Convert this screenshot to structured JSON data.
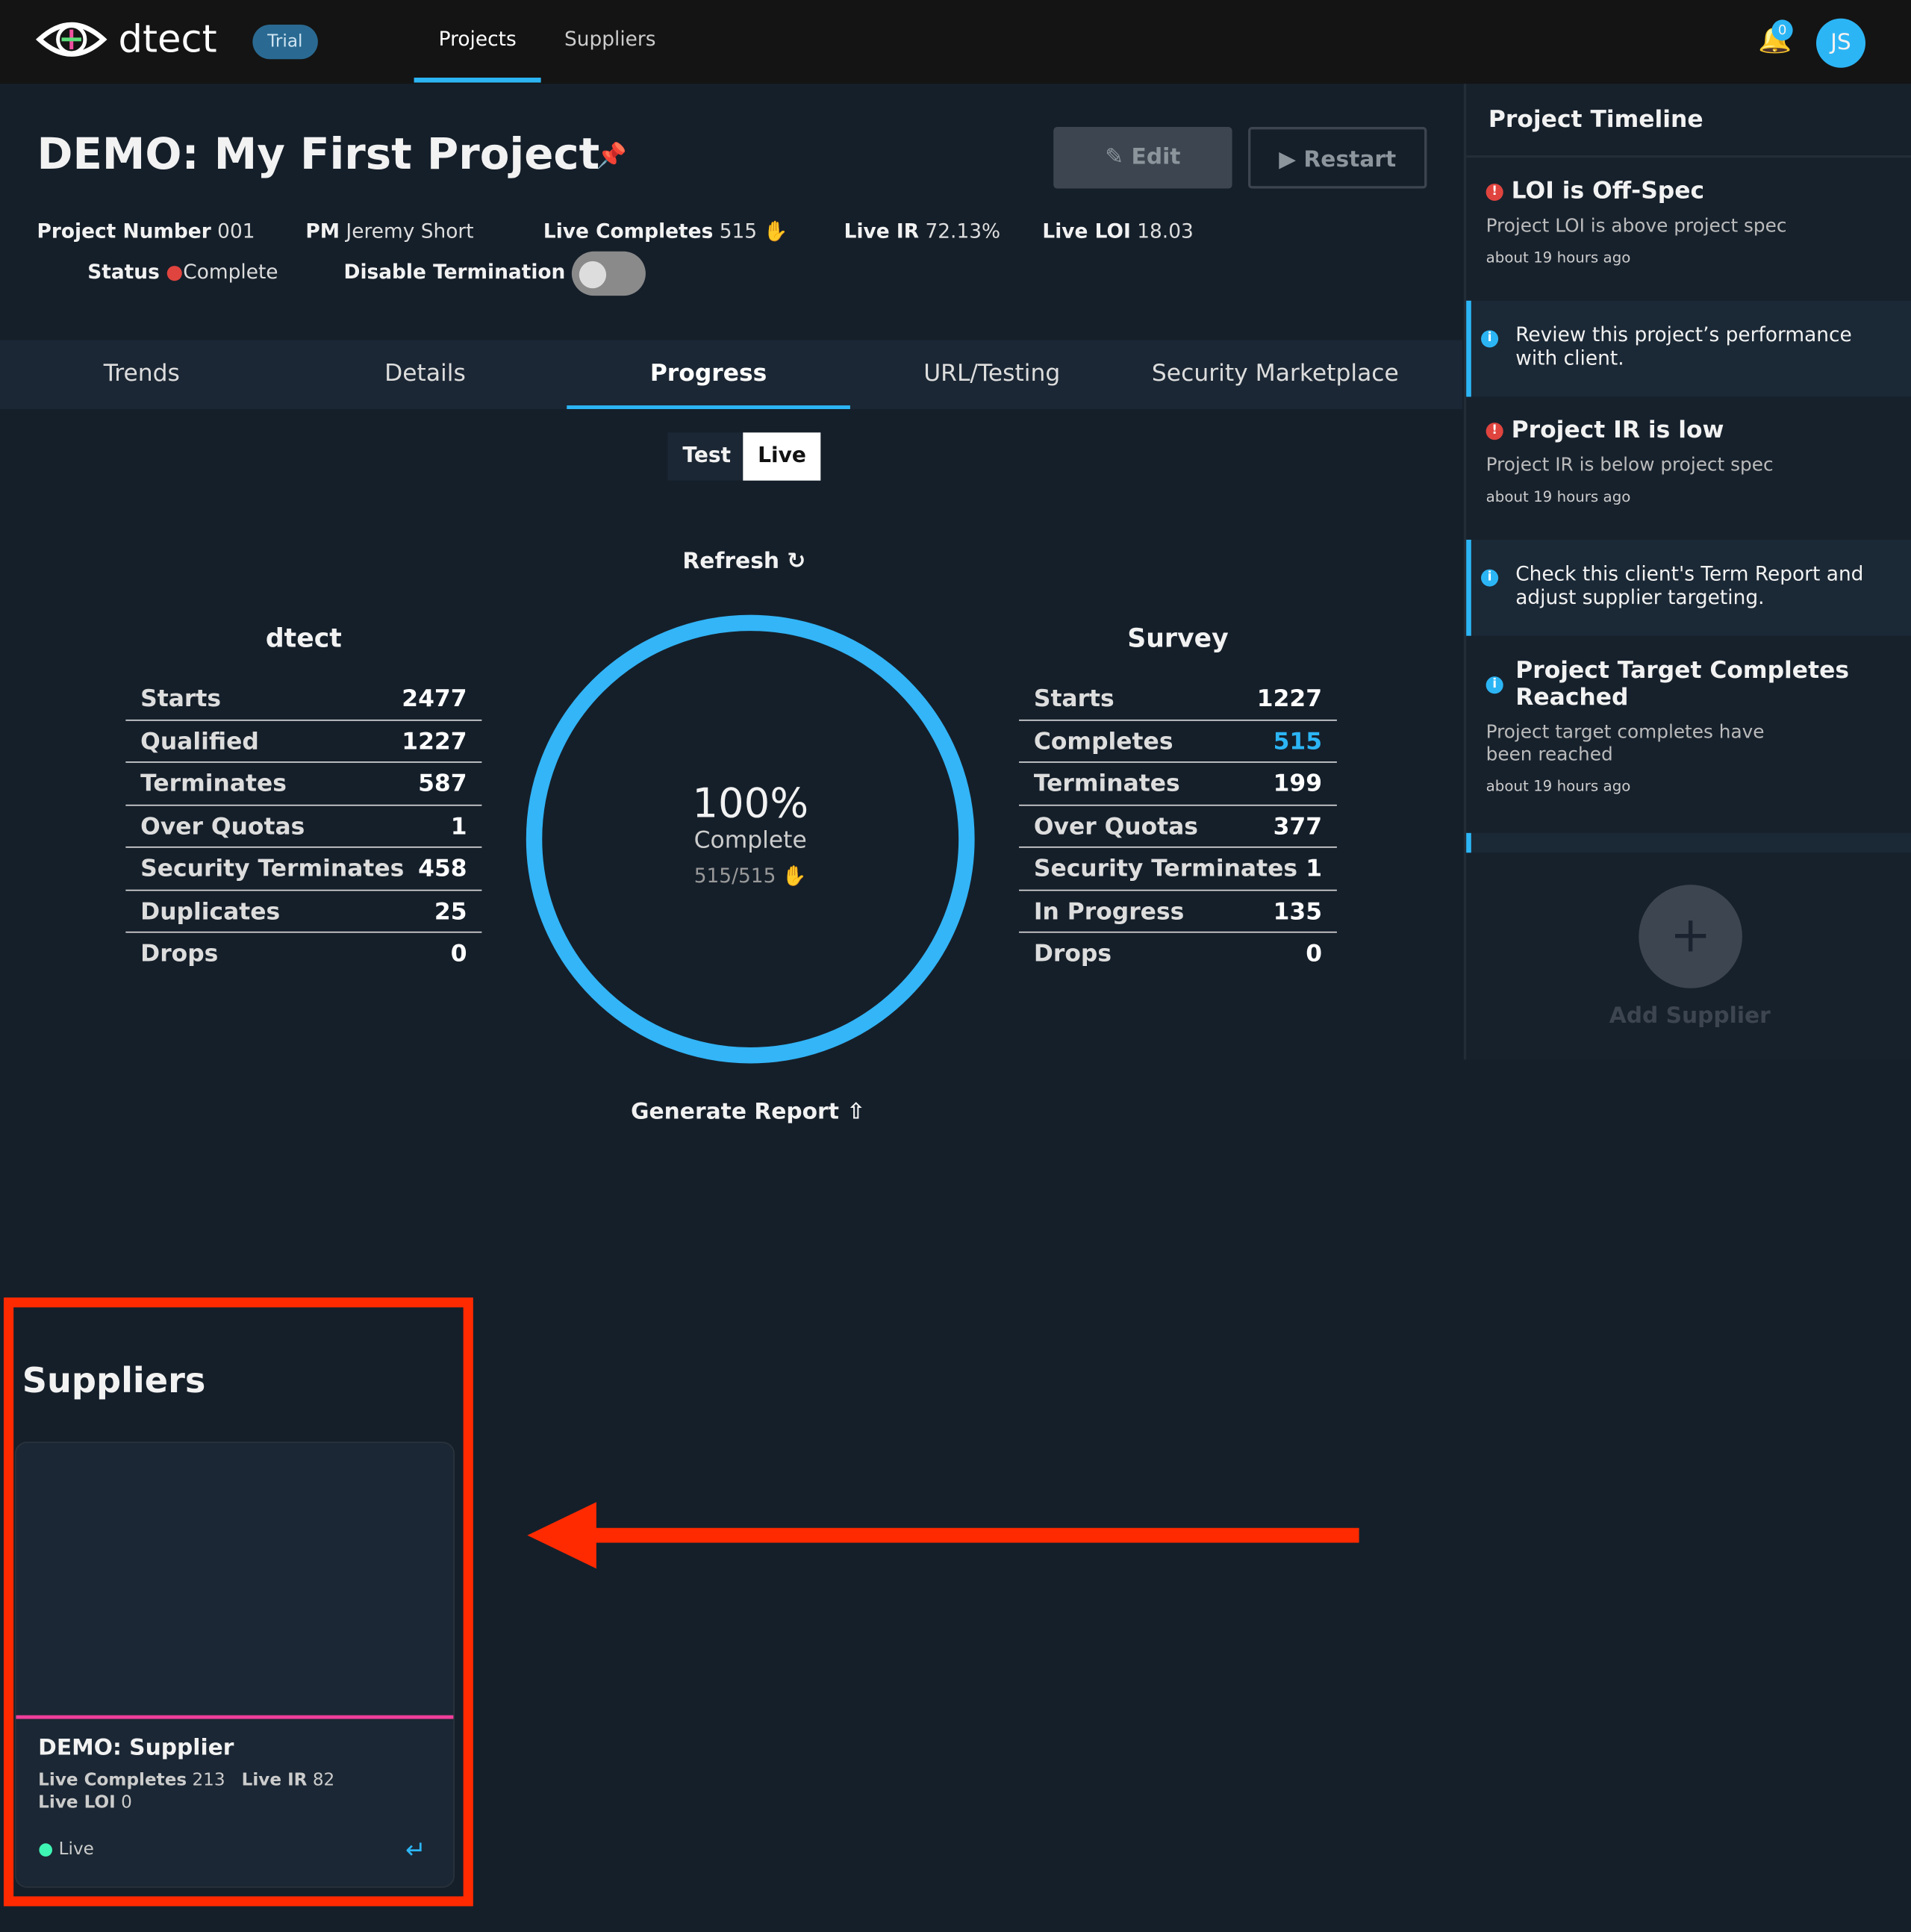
{
  "colors": {
    "accent": "#2cb5f5",
    "status_complete": "#e0443e",
    "live": "#3ef5b4",
    "annotation": "#ff2a00"
  },
  "nav": {
    "brand": "dtect",
    "badge": "Trial",
    "items": [
      {
        "label": "Projects",
        "active": true
      },
      {
        "label": "Suppliers"
      }
    ],
    "notifications": "0",
    "avatar": "JS"
  },
  "project": {
    "title": "DEMO: My First Project",
    "edit": "Edit",
    "restart": "Restart",
    "number_label": "Project Number",
    "number": "001",
    "pm_label": "PM",
    "pm": "Jeremy Short",
    "live_completes_label": "Live Completes",
    "live_completes": "515",
    "live_ir_label": "Live IR",
    "live_ir": "72.13%",
    "live_loi_label": "Live LOI",
    "live_loi": "18.03",
    "status_label": "Status",
    "status": "Complete",
    "disable_term_label": "Disable Termination",
    "disable_term_on": false
  },
  "tabs": [
    "Trends",
    "Details",
    "Progress",
    "URL/Testing",
    "Security Marketplace"
  ],
  "active_tab": "Progress",
  "mode": {
    "test": "Test",
    "live": "Live",
    "selected": "Live"
  },
  "refresh": "Refresh",
  "dtect": {
    "title": "dtect",
    "rows": [
      [
        "Starts",
        "2477"
      ],
      [
        "Qualified",
        "1227"
      ],
      [
        "Terminates",
        "587"
      ],
      [
        "Over Quotas",
        "1"
      ],
      [
        "Security Terminates",
        "458"
      ],
      [
        "Duplicates",
        "25"
      ],
      [
        "Drops",
        "0"
      ]
    ]
  },
  "survey": {
    "title": "Survey",
    "rows": [
      [
        "Starts",
        "1227"
      ],
      [
        "Completes",
        "515"
      ],
      [
        "Terminates",
        "199"
      ],
      [
        "Over Quotas",
        "377"
      ],
      [
        "Security Terminates",
        "1"
      ],
      [
        "In Progress",
        "135"
      ],
      [
        "Drops",
        "0"
      ]
    ]
  },
  "progress": {
    "percent": "100%",
    "label": "Complete",
    "count": "515/515",
    "fraction": 1.0
  },
  "generate_report": "Generate Report",
  "timeline": {
    "title": "Project Timeline",
    "items": [
      {
        "type": "alert",
        "title": "LOI is Off-Spec",
        "desc": "Project LOI is above project spec",
        "time": "about 19 hours ago"
      },
      {
        "type": "tip",
        "text": "Review this project’s performance with client."
      },
      {
        "type": "alert",
        "title": "Project IR is low",
        "desc": "Project IR is below project spec",
        "time": "about 19 hours ago"
      },
      {
        "type": "tip",
        "text": "Check this client's Term Report and adjust supplier targeting."
      },
      {
        "type": "info",
        "title": "Project Target Completes Reached",
        "desc": "Project target completes have been reached",
        "time": "about 19 hours ago"
      }
    ],
    "add_supplier": "Add Supplier"
  },
  "suppliers": {
    "title": "Suppliers",
    "cards": [
      {
        "name": "DEMO: Supplier",
        "live_completes_label": "Live Completes",
        "live_completes": "213",
        "live_ir_label": "Live IR",
        "live_ir": "82",
        "live_loi_label": "Live LOI",
        "live_loi": "0",
        "status": "Live"
      }
    ]
  }
}
